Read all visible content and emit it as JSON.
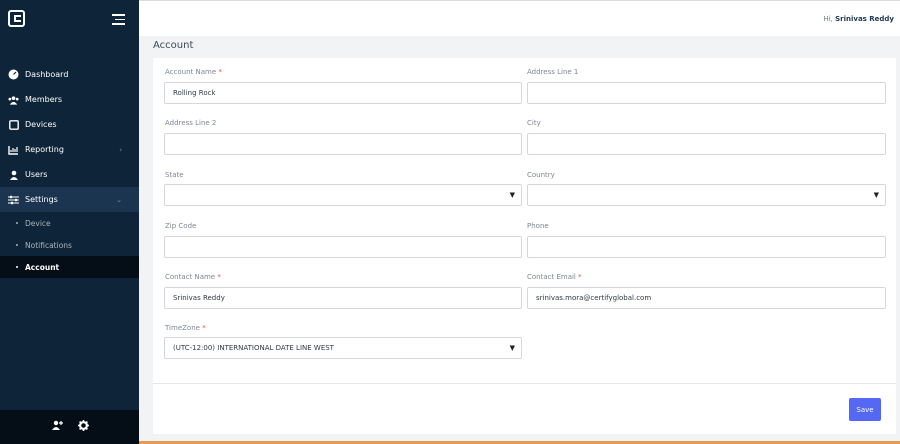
{
  "header": {
    "greeting_prefix": "Hi,",
    "user_name": "Srinivas Reddy"
  },
  "page": {
    "title": "Account"
  },
  "sidebar": {
    "items": [
      {
        "label": "Dashboard",
        "icon": "dashboard-gauge-icon"
      },
      {
        "label": "Members",
        "icon": "members-group-icon"
      },
      {
        "label": "Devices",
        "icon": "tablet-icon"
      },
      {
        "label": "Reporting",
        "icon": "chart-icon",
        "chevron": "›"
      },
      {
        "label": "Users",
        "icon": "user-icon"
      },
      {
        "label": "Settings",
        "icon": "sliders-icon",
        "chevron": "⌄"
      }
    ],
    "subitems": [
      {
        "label": "Device"
      },
      {
        "label": "Notifications"
      },
      {
        "label": "Account"
      }
    ]
  },
  "form": {
    "account_name": {
      "label": "Account Name",
      "value": "Rolling Rock",
      "required": "*"
    },
    "address1": {
      "label": "Address Line 1",
      "value": ""
    },
    "address2": {
      "label": "Address Line 2",
      "value": ""
    },
    "city": {
      "label": "City",
      "value": ""
    },
    "state": {
      "label": "State",
      "value": ""
    },
    "country": {
      "label": "Country",
      "value": ""
    },
    "zip": {
      "label": "Zip Code",
      "value": ""
    },
    "phone": {
      "label": "Phone",
      "value": ""
    },
    "contact_name": {
      "label": "Contact Name",
      "value": "Srinivas Reddy",
      "required": "*"
    },
    "contact_email": {
      "label": "Contact Email",
      "value": "srinivas.mora@certifyglobal.com",
      "required": "*"
    },
    "timezone": {
      "label": "TimeZone",
      "value": "(UTC-12:00) INTERNATIONAL DATE LINE WEST",
      "required": "*"
    },
    "caret": "▼"
  },
  "actions": {
    "save_label": "Save"
  },
  "colors": {
    "sidebar": "#0e2438",
    "accent": "#5468f3",
    "required": "#e34a4a"
  }
}
